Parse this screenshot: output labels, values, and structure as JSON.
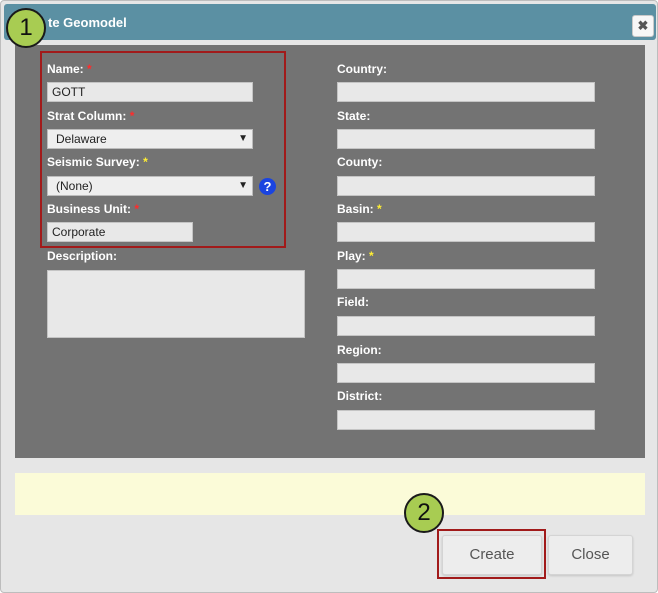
{
  "dialog": {
    "title": "te Geomodel",
    "close_icon": "close-icon"
  },
  "badges": {
    "one": "1",
    "two": "2"
  },
  "form": {
    "left": {
      "name": {
        "label": "Name:",
        "required": "*",
        "value": "GOTT"
      },
      "strat_column": {
        "label": "Strat Column:",
        "required": "*",
        "selected": "Delaware"
      },
      "seismic_survey": {
        "label": "Seismic Survey:",
        "required": "*",
        "selected": "(None)",
        "help": "?"
      },
      "business_unit": {
        "label": "Business Unit:",
        "required": "*",
        "value": "Corporate"
      },
      "description": {
        "label": "Description:",
        "value": ""
      }
    },
    "right": {
      "country": {
        "label": "Country:",
        "value": ""
      },
      "state": {
        "label": "State:",
        "value": ""
      },
      "county": {
        "label": "County:",
        "value": ""
      },
      "basin": {
        "label": "Basin:",
        "required": "*",
        "value": ""
      },
      "play": {
        "label": "Play:",
        "required": "*",
        "value": ""
      },
      "field": {
        "label": "Field:",
        "value": ""
      },
      "region": {
        "label": "Region:",
        "value": ""
      },
      "district": {
        "label": "District:",
        "value": ""
      }
    }
  },
  "buttons": {
    "create": "Create",
    "close": "Close"
  },
  "colors": {
    "titlebar": "#5b90a3",
    "form_bg": "#737373",
    "highlight": "#a11a1a",
    "badge": "#a8cc52",
    "required_red": "#ff2b2b",
    "required_yellow": "#ffee33",
    "help": "#1a44e0"
  }
}
